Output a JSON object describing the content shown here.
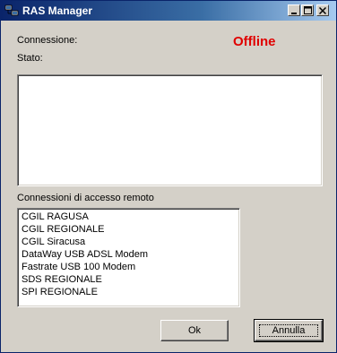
{
  "window": {
    "title": "RAS Manager"
  },
  "labels": {
    "connection": "Connessione:",
    "state": "Stato:",
    "remote_connections": "Connessioni di accesso remoto"
  },
  "status": {
    "text": "Offline",
    "color": "#e00000"
  },
  "connections": [
    "CGIL RAGUSA",
    "CGIL REGIONALE",
    "CGIL Siracusa",
    "DataWay USB ADSL Modem",
    "Fastrate USB 100 Modem",
    "SDS REGIONALE",
    "SPI REGIONALE"
  ],
  "buttons": {
    "ok": "Ok",
    "cancel": "Annulla"
  },
  "icons": {
    "app": "network-computers-icon",
    "minimize": "minimize-icon",
    "maximize": "maximize-icon",
    "close": "close-icon"
  }
}
